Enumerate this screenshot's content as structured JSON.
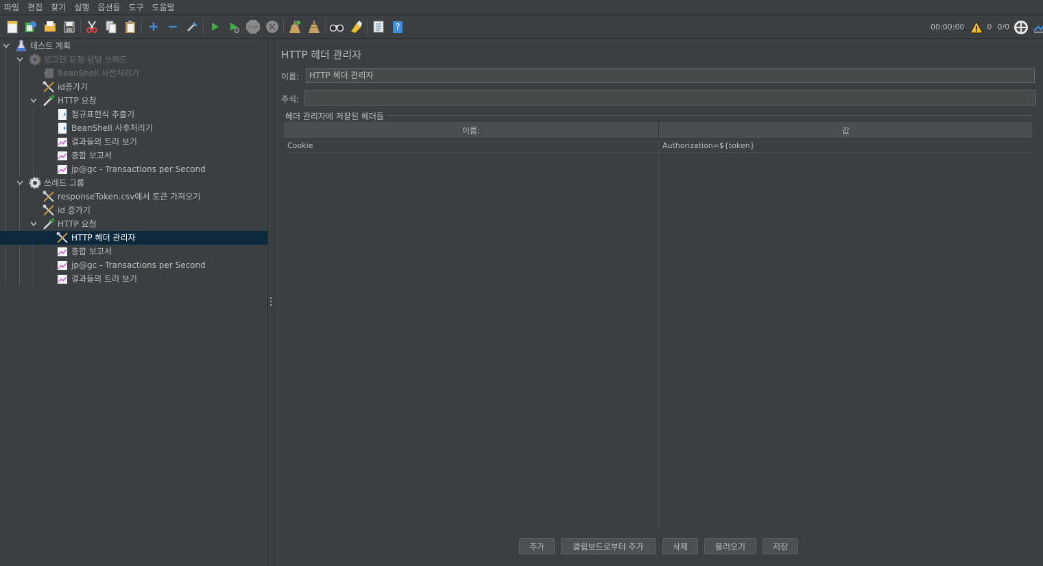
{
  "menu": [
    "파일",
    "편집",
    "찾기",
    "실행",
    "옵션들",
    "도구",
    "도움말"
  ],
  "toolbar": {
    "buttons": [
      "new-icon",
      "templates-icon",
      "open-icon",
      "save-icon",
      "cut-icon",
      "copy-icon",
      "paste-icon",
      "expand-icon",
      "collapse-icon",
      "toggle-icon",
      "start-icon",
      "start-no-pause-icon",
      "stop-icon",
      "shutdown-icon",
      "clear-icon",
      "clear-all-icon",
      "search-icon",
      "reset-search-icon",
      "function-helper-icon",
      "help-icon"
    ],
    "elapsed": "00:00:00",
    "warnings": "0",
    "threads": "0/0"
  },
  "tree": [
    {
      "label": "테스트 계획",
      "icon": "flask-icon",
      "disabled": false
    },
    {
      "label": "로그인 요청 담당 쓰레드",
      "icon": "gear-icon",
      "disabled": true
    },
    {
      "label": "BeanShell 사전처리기",
      "icon": "preprocessor-icon",
      "disabled": true
    },
    {
      "label": "id증가기",
      "icon": "tools-icon",
      "disabled": false
    },
    {
      "label": "HTTP 요청",
      "icon": "pipette-icon",
      "disabled": false
    },
    {
      "label": "정규표현식 추출기",
      "icon": "document-icon",
      "disabled": false
    },
    {
      "label": "BeanShell 사후처리기",
      "icon": "document-icon",
      "disabled": false
    },
    {
      "label": "결과들의 트리 보기",
      "icon": "graph-icon",
      "disabled": false
    },
    {
      "label": "총합 보고서",
      "icon": "graph-icon",
      "disabled": false
    },
    {
      "label": "jp@gc - Transactions per Second",
      "icon": "graph-icon",
      "disabled": false
    },
    {
      "label": "쓰레드 그룹",
      "icon": "gear-icon",
      "disabled": false
    },
    {
      "label": "responseToken.csv에서 토큰 가져오기",
      "icon": "tools-icon",
      "disabled": false
    },
    {
      "label": "id 증가기",
      "icon": "tools-icon",
      "disabled": false
    },
    {
      "label": "HTTP 요청",
      "icon": "pipette-icon",
      "disabled": false
    },
    {
      "label": "HTTP 헤더 관리자",
      "icon": "tools-icon",
      "disabled": false,
      "selected": true
    },
    {
      "label": "총합 보고서",
      "icon": "graph-icon",
      "disabled": false
    },
    {
      "label": "jp@gc - Transactions per Second",
      "icon": "graph-icon",
      "disabled": false
    },
    {
      "label": "결과들의 트리 보기",
      "icon": "graph-icon",
      "disabled": false
    }
  ],
  "panel": {
    "title": "HTTP 헤더 관리자",
    "name_label": "이름:",
    "name_value": "HTTP 헤더 관리자",
    "comment_label": "주석:",
    "comment_value": "",
    "group_title": "헤더 관리자에 저장된 헤더들",
    "table": {
      "headers": [
        "이름:",
        "값"
      ],
      "rows": [
        [
          "Cookie",
          "Authorization=${token}"
        ]
      ]
    },
    "buttons": [
      "추가",
      "클립보드로부터 추가",
      "삭제",
      "불러오기",
      "저장"
    ]
  },
  "colors": {
    "background": "#3c3f41",
    "selection": "#0d293e",
    "text": "#bbbbbb",
    "run_green": "#3fae3f",
    "accent_blue": "#3f8fd8"
  }
}
